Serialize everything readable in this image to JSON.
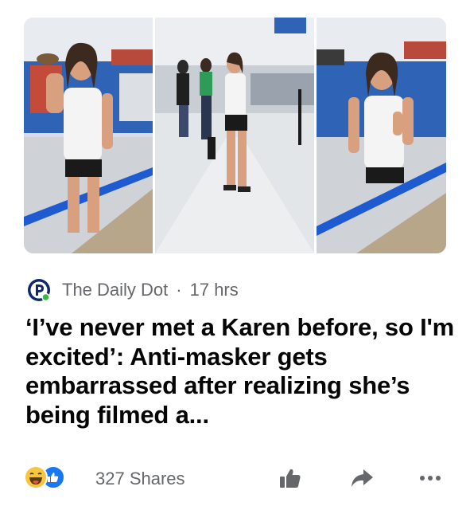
{
  "post": {
    "images": [
      {
        "alt_icon": "store-frame-woman-shouting"
      },
      {
        "alt_icon": "store-frame-woman-walking"
      },
      {
        "alt_icon": "store-frame-woman-talking"
      }
    ],
    "source": {
      "name": "The Daily Dot",
      "separator": "·",
      "time": "17 hrs",
      "logo_icon": "daily-dot-logo-icon",
      "logo_color": "#0f2a6b",
      "logo_dot_color": "#39b54a"
    },
    "headline": "‘I’ve never met a Karen before, so I'm excited’: Anti-masker gets embarrassed after realizing she’s being filmed a...",
    "footer": {
      "reactions": [
        "haha-reaction-icon",
        "like-reaction-icon"
      ],
      "shares_text": "327 Shares",
      "actions": [
        "like-icon",
        "share-icon",
        "more-icon"
      ],
      "icon_color": "#65676b"
    }
  }
}
